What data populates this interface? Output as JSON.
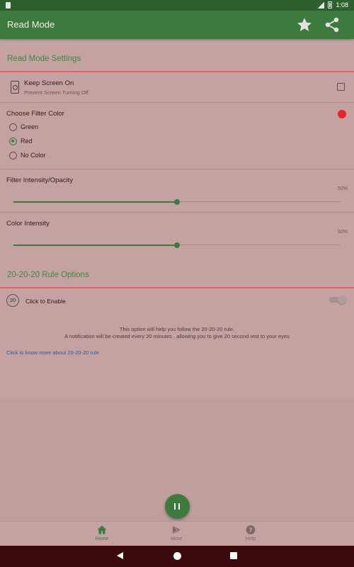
{
  "status_bar": {
    "time": "1:08"
  },
  "app_bar": {
    "title": "Read Mode"
  },
  "read_mode_settings": {
    "section_title": "Read Mode Settings",
    "keep_screen_on": {
      "title": "Keep Screen On",
      "subtitle": "Prevent Screen Turning Off",
      "checked": false
    },
    "filter_color": {
      "label": "Choose Filter Color",
      "selected": "Red",
      "indicator_color": "#e5232b",
      "options": [
        {
          "label": "Green",
          "checked": false
        },
        {
          "label": "Red",
          "checked": true
        },
        {
          "label": "No Color",
          "checked": false
        }
      ]
    },
    "filter_intensity": {
      "label": "Filter Intensity/Opacity",
      "value_text": "50%",
      "value": 50
    },
    "color_intensity": {
      "label": "Color Intensity",
      "value_text": "50%",
      "value": 50
    }
  },
  "rule_20_20_20": {
    "section_title": "20-20-20 Rule Options",
    "badge": "20",
    "enable_label": "Click to Enable",
    "enabled": false,
    "info_line1": "This option will help you follow the 20-20-20 rule.",
    "info_line2": "A notification will be created every 20 minutes , allowing you to give 20 second rest to your eyes",
    "link_text": "Click to know more about 20-20-20 rule"
  },
  "fab": {
    "icon": "pause-icon"
  },
  "bottom_nav": [
    {
      "label": "Home",
      "icon": "home-icon",
      "active": true
    },
    {
      "label": "More",
      "icon": "play-store-icon",
      "active": false
    },
    {
      "label": "Help",
      "icon": "help-icon",
      "active": false
    }
  ],
  "colors": {
    "primary": "#3d7a3e",
    "primary_dark": "#2c612f",
    "accent_line": "#e35f62",
    "background_tint": "#c4a2a2",
    "link": "#2a5b9a",
    "system_nav": "#3a0909"
  }
}
